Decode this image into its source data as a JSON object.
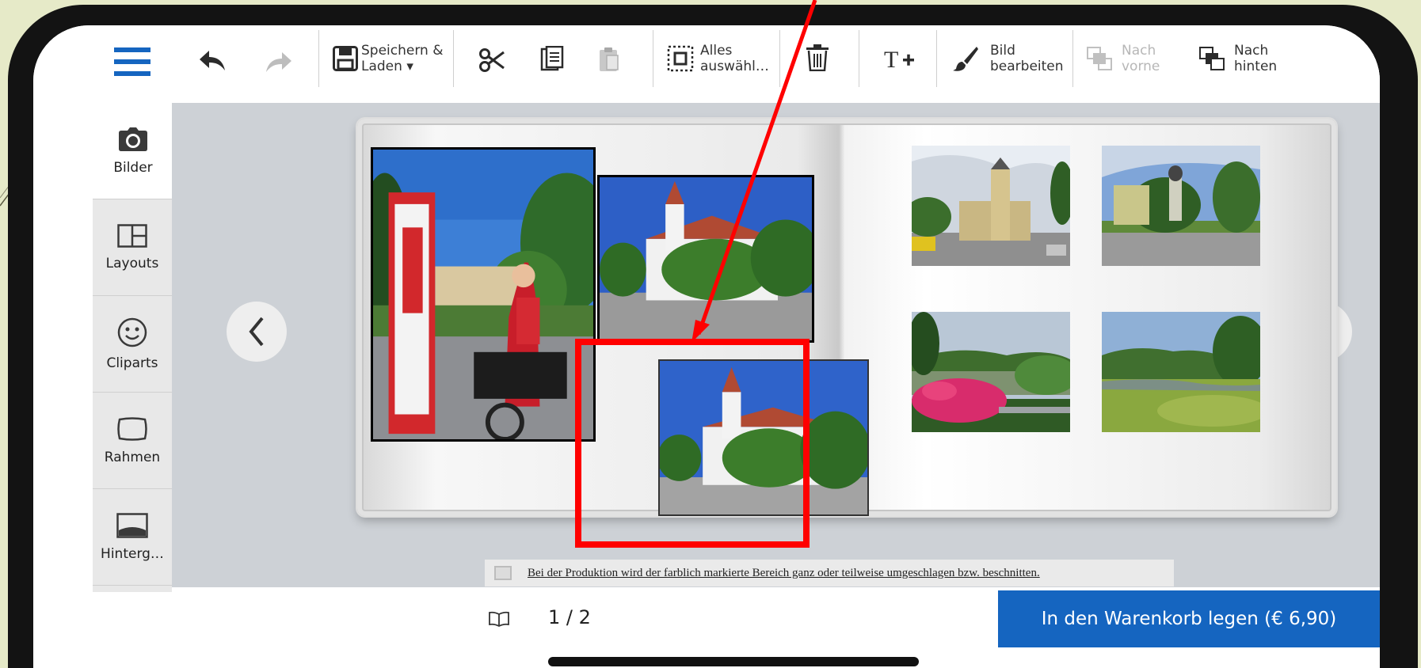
{
  "toolbar": {
    "undo_icon": "undo-icon",
    "redo_icon": "redo-icon",
    "save_label_line1": "Speichern &",
    "save_label_line2": "Laden ▾",
    "select_all_line1": "Alles",
    "select_all_line2": "auswähl…",
    "edit_image_line1": "Bild",
    "edit_image_line2": "bearbeiten",
    "bring_forward_line1": "Nach",
    "bring_forward_line2": "vorne",
    "send_backward_line1": "Nach",
    "send_backward_line2": "hinten"
  },
  "sidebar": {
    "items": [
      {
        "label": "Bilder",
        "icon": "camera-icon"
      },
      {
        "label": "Layouts",
        "icon": "layout-icon"
      },
      {
        "label": "Cliparts",
        "icon": "smiley-icon"
      },
      {
        "label": "Rahmen",
        "icon": "frame-icon"
      },
      {
        "label": "Hinterg…",
        "icon": "background-icon"
      }
    ]
  },
  "notice": {
    "text": "Bei der Produktion wird der farblich markierte Bereich ganz oder teilweise umgeschlagen bzw. beschnitten."
  },
  "footer": {
    "page_indicator": "1 / 2",
    "cart_button": "In den Warenkorb legen (€ 6,90)"
  },
  "colors": {
    "accent": "#1565c0",
    "annotation": "#ff0000",
    "background": "#e6eac8"
  }
}
